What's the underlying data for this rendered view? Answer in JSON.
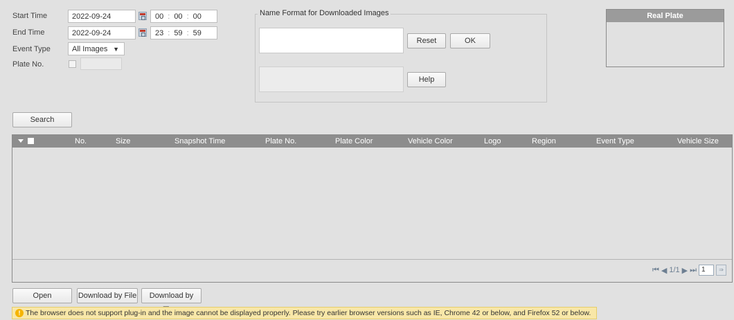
{
  "filters": {
    "start_time_label": "Start Time",
    "start_date": "2022-09-24",
    "start_hh": "00",
    "start_mm": "00",
    "start_ss": "00",
    "end_time_label": "End Time",
    "end_date": "2022-09-24",
    "end_hh": "23",
    "end_mm": "59",
    "end_ss": "59",
    "event_type_label": "Event Type",
    "event_type_value": "All Images",
    "plate_no_label": "Plate No.",
    "plate_no_value": ""
  },
  "name_format": {
    "legend": "Name Format for Downloaded Images",
    "reset_label": "Reset",
    "ok_label": "OK",
    "help_label": "Help"
  },
  "real_plate": {
    "title": "Real Plate"
  },
  "search_label": "Search",
  "table": {
    "columns": [
      "No.",
      "Size",
      "Snapshot Time",
      "Plate No.",
      "Plate Color",
      "Vehicle Color",
      "Logo",
      "Region",
      "Event Type",
      "Vehicle Size"
    ],
    "rows": []
  },
  "pager": {
    "page_info": "1/1",
    "page_input": "1"
  },
  "actions": {
    "open_label": "Open",
    "download_by_file_label": "Download by File",
    "download_by_time_label": "Download by Time"
  },
  "notice": {
    "text": "The browser does not support plug-in and the image cannot be displayed properly. Please try earlier browser versions such as IE, Chrome 42 or below, and Firefox 52 or below."
  }
}
